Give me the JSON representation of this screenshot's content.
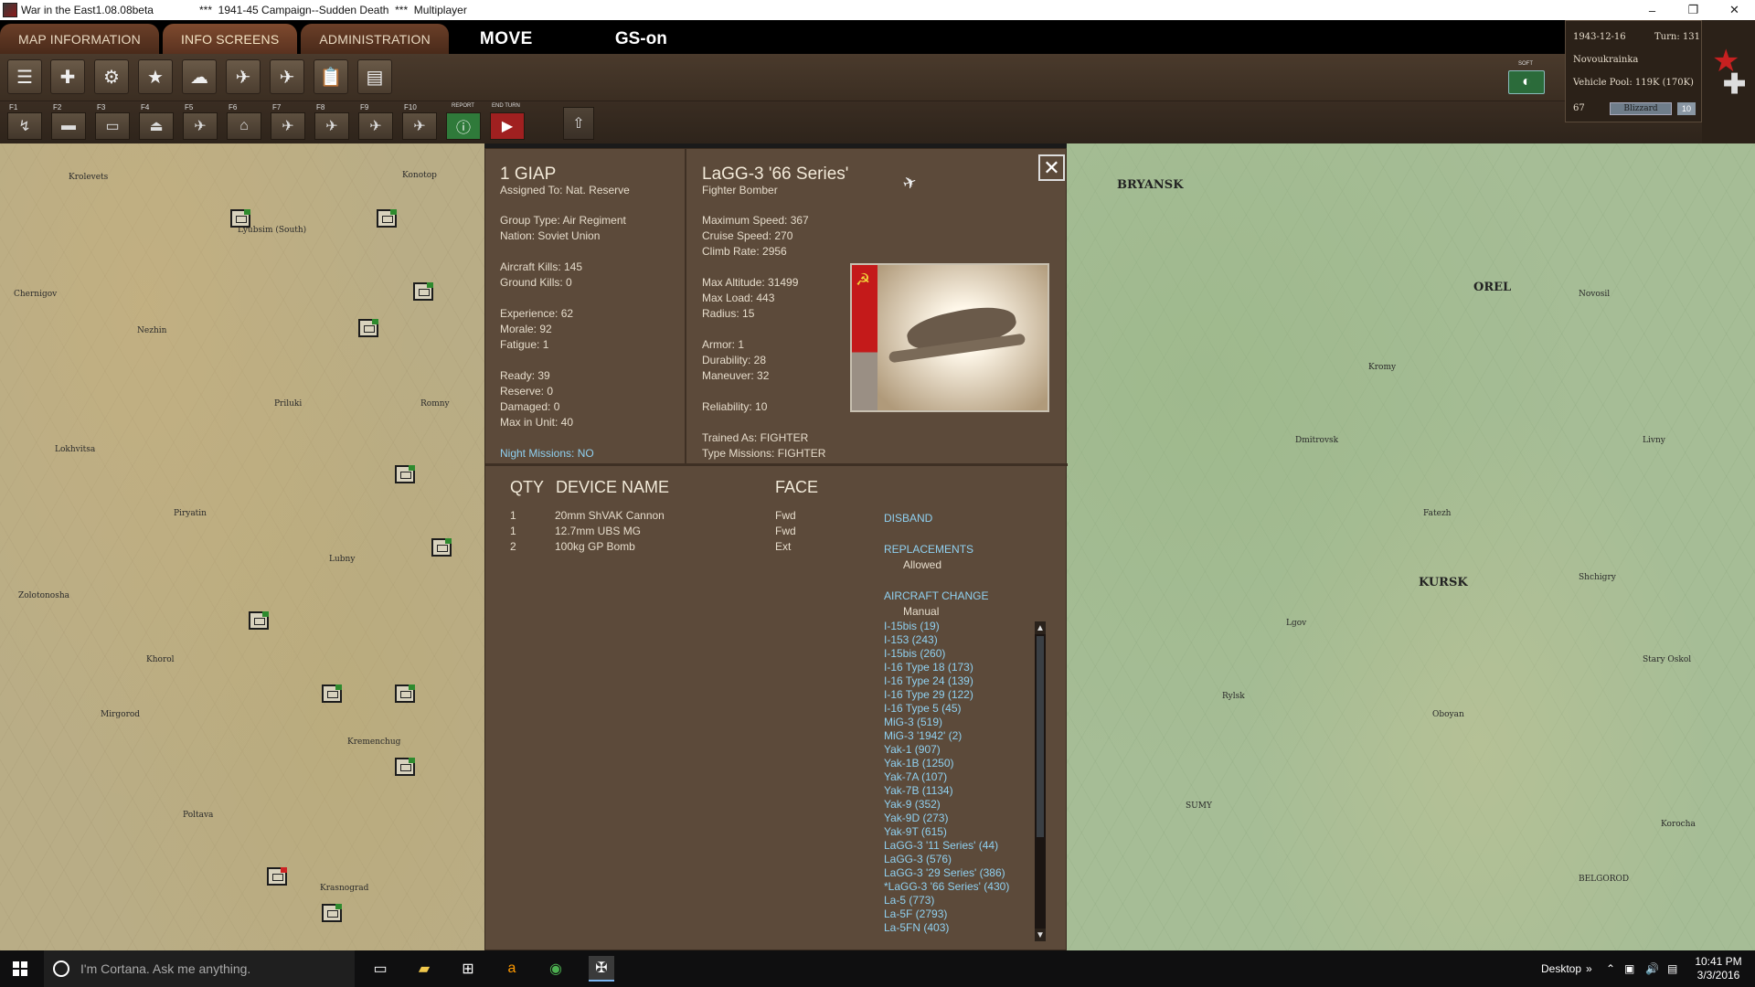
{
  "titlebar": {
    "app": "War in the East1.08.08beta",
    "campaign": "***  1941-45 Campaign--Sudden Death  ***  Multiplayer"
  },
  "menu": {
    "tabs": [
      "MAP INFORMATION",
      "INFO SCREENS",
      "ADMINISTRATION"
    ],
    "mode": "MOVE",
    "gs": "GS-on"
  },
  "toolbar2": {
    "fkeys": [
      "F1",
      "F2",
      "F3",
      "F4",
      "F5",
      "F6",
      "F7",
      "F8",
      "F9",
      "F10"
    ],
    "report": "REPORT",
    "end_turn": "END TURN"
  },
  "soft_label": "SOFT",
  "info": {
    "date": "1943-12-16",
    "turn": "Turn: 131",
    "location": "Novoukrainka",
    "vehicle_pool": "Vehicle Pool: 119K (170K)",
    "value": "67",
    "weather": "Blizzard",
    "weather_num": "10"
  },
  "unit": {
    "name": "1 GIAP",
    "assigned": "Assigned To: Nat. Reserve",
    "group_type": "Group Type: Air Regiment",
    "nation": "Nation: Soviet Union",
    "aircraft_kills": "Aircraft Kills: 145",
    "ground_kills": "Ground Kills: 0",
    "experience": "Experience: 62",
    "morale": "Morale: 92",
    "fatigue": "Fatigue: 1",
    "ready": "Ready: 39",
    "reserve": "Reserve: 0",
    "damaged": "Damaged: 0",
    "max_in_unit": "Max in Unit:  40",
    "night_missions": "Night Missions: NO"
  },
  "aircraft": {
    "name": "LaGG-3 '66 Series'",
    "role": "Fighter Bomber",
    "max_speed": "Maximum Speed: 367",
    "cruise_speed": "Cruise Speed: 270",
    "climb_rate": "Climb Rate: 2956",
    "max_altitude": "Max Altitude: 31499",
    "max_load": "Max Load: 443",
    "radius": "Radius: 15",
    "armor": "Armor: 1",
    "durability": "Durability: 28",
    "maneuver": "Maneuver: 32",
    "reliability": "Reliability: 10",
    "trained_as": "Trained As:  FIGHTER",
    "type_missions": "Type Missions: FIGHTER"
  },
  "devices": {
    "headers": {
      "qty": "QTY",
      "name": "DEVICE NAME",
      "face": "FACE"
    },
    "rows": [
      {
        "qty": "1",
        "name": "20mm ShVAK Cannon",
        "face": "Fwd"
      },
      {
        "qty": "1",
        "name": "12.7mm UBS MG",
        "face": "Fwd"
      },
      {
        "qty": "2",
        "name": "100kg GP Bomb",
        "face": "Ext"
      }
    ]
  },
  "actions": {
    "disband": "DISBAND",
    "replacements": "REPLACEMENTS",
    "replacements_value": "Allowed",
    "aircraft_change": "AIRCRAFT CHANGE",
    "aircraft_change_value": "Manual",
    "list": [
      "I-15bis (19)",
      "I-153 (243)",
      "I-15bis (260)",
      "I-16 Type 18 (173)",
      "I-16 Type 24 (139)",
      "I-16 Type 29 (122)",
      "I-16 Type 5 (45)",
      "MiG-3 (519)",
      "MiG-3 '1942' (2)",
      "Yak-1 (907)",
      "Yak-1B (1250)",
      "Yak-7A (107)",
      "Yak-7B (1134)",
      "Yak-9 (352)",
      "Yak-9D (273)",
      "Yak-9T (615)",
      "LaGG-3 '11 Series' (44)",
      "LaGG-3 (576)",
      "LaGG-3 '29 Series' (386)",
      "*LaGG-3 '66 Series' (430)",
      "La-5 (773)",
      "La-5F (2793)",
      "La-5FN (403)"
    ]
  },
  "map_labels_left": [
    "Krolevets",
    "Lyubsim (South)",
    "Konotop",
    "Chernigov",
    "Nezhin",
    "Priluki",
    "Romny",
    "Lokhvitsa",
    "Piryatin",
    "Lubny",
    "Zolotonosha",
    "Khorol",
    "Mirgorod",
    "Kremenchug",
    "Poltava",
    "Krasnograd"
  ],
  "map_labels_right": [
    "BRYANSK",
    "OREL",
    "KURSK",
    "BELGOROD",
    "SUMY",
    "Novosil",
    "Livny",
    "Kromy",
    "Dmitrovsk",
    "Fatezh",
    "Oboyan",
    "Shchigry",
    "Lgov",
    "Rylsk",
    "Korocha",
    "Stary Oskol"
  ],
  "taskbar": {
    "search_placeholder": "I'm Cortana. Ask me anything.",
    "desktop": "Desktop",
    "time": "10:41 PM",
    "date": "3/3/2016"
  },
  "colors": {
    "panel_bg": "#5c4a3a",
    "link": "#8fd0f0",
    "menu_tab": "#6b3f28"
  }
}
